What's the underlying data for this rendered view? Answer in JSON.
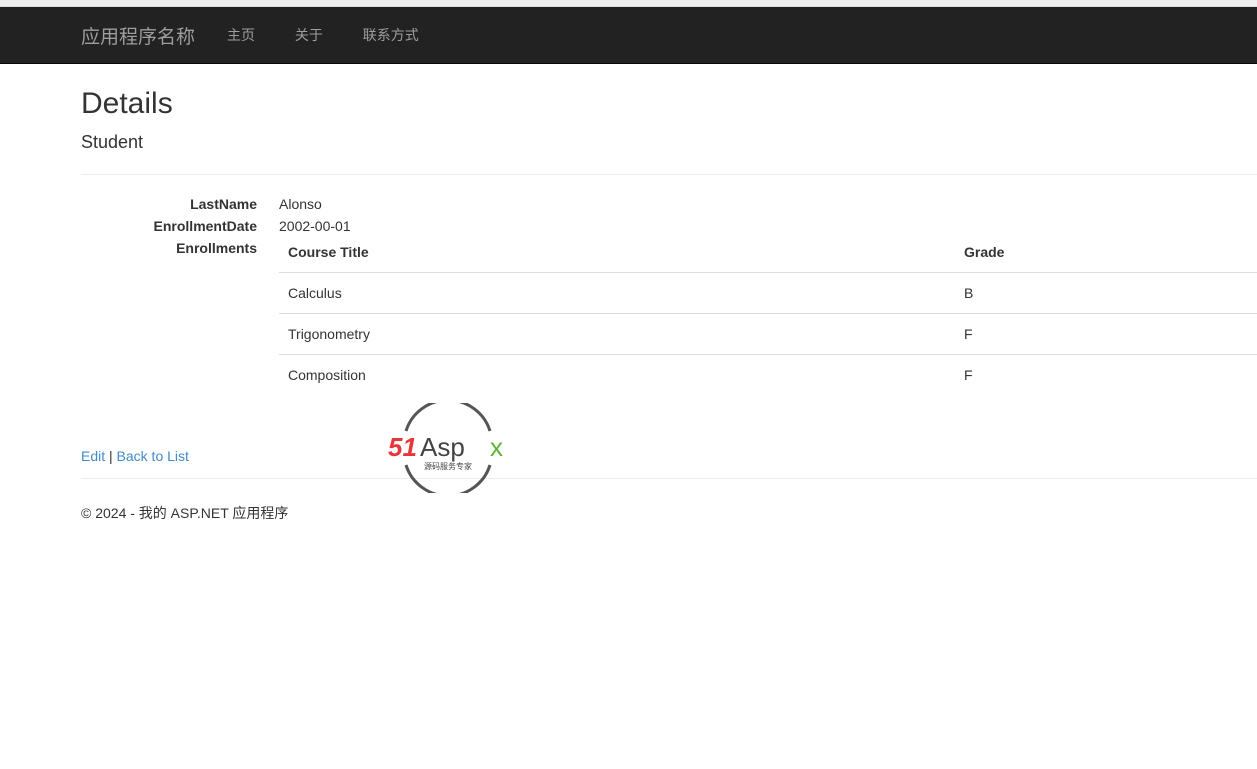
{
  "navbar": {
    "brand": "应用程序名称",
    "items": [
      "主页",
      "关于",
      "联系方式"
    ]
  },
  "page": {
    "title": "Details",
    "subtitle": "Student"
  },
  "fields": {
    "last_name_label": "LastName",
    "last_name": "Alonso",
    "enrollment_date_label": "EnrollmentDate",
    "enrollment_date": "2002-00-01",
    "enrollments_label": "Enrollments"
  },
  "enrollments": {
    "headers": [
      "Course Title",
      "Grade"
    ],
    "rows": [
      [
        "Calculus",
        "B"
      ],
      [
        "Trigonometry",
        "F"
      ],
      [
        "Composition",
        "F"
      ]
    ]
  },
  "links": {
    "edit": "Edit",
    "separator": "|",
    "back": "Back to List"
  },
  "footer": {
    "text": "© 2024 - 我的 ASP.NET 应用程序"
  },
  "watermark": {
    "brand": "51Aspx",
    "tagline": "源码服务专家"
  }
}
